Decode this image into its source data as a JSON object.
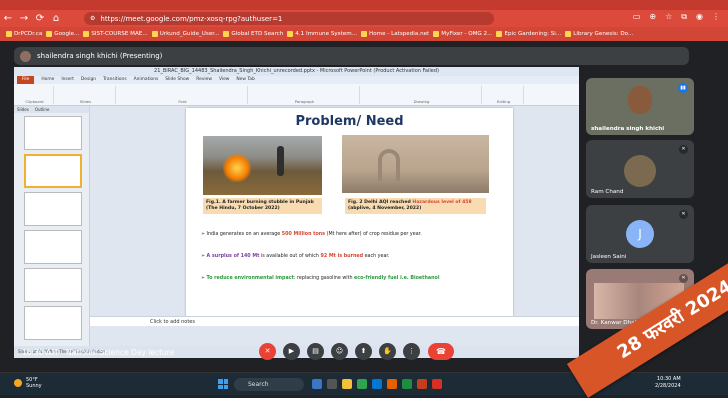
{
  "browser": {
    "url": "https://meet.google.com/pmz-xosq-rpg?authuser=1",
    "bookmarks": [
      "DrPCDr.ca",
      "Google...",
      "SIST-COURSE MAE...",
      "Urkund_Guide_User...",
      "Global ETD Search",
      "4.1 Immune System...",
      "Home - Latspedia.net",
      "MyFixer - OMG 2...",
      "Epic Gardening: Si...",
      "Library Genesis: Do..."
    ]
  },
  "meet": {
    "presenter_banner": "shailendra singh khichi (Presenting)",
    "clock": "10:30 AM",
    "meeting_title": "National Science Day lecture",
    "participants": [
      {
        "name": "shailendra singh khichi",
        "muted": false
      },
      {
        "name": "Ram Chand",
        "muted": true
      },
      {
        "name": "Jasleen Saini",
        "initial": "J",
        "muted": true
      },
      {
        "name": "Dr. Kanwar Dhaliwal",
        "muted": true
      }
    ]
  },
  "ppt": {
    "title_bar": "21_BIRAC_BIG_14483_Shailendra_Singh_Khichi_unrecorded.pptx - Microsoft PowerPoint (Product Activation Failed)",
    "tabs": [
      "File",
      "Home",
      "Insert",
      "Design",
      "Transitions",
      "Animations",
      "Slide Show",
      "Review",
      "View",
      "New Tab"
    ],
    "groups": [
      "Clipboard",
      "Slides",
      "Font",
      "Paragraph",
      "Drawing",
      "Editing"
    ],
    "pane_tabs": [
      "Slides",
      "Outline"
    ],
    "notes_placeholder": "Click to add notes",
    "status": "Slide 2 of 40   \"Office Theme\"   English (India)"
  },
  "slide": {
    "title": "Problem/ Need",
    "caption1": "Fig.1. A farmer burning  stubble in Punjab (The Hindu, 7 October 2022)",
    "caption2_pre": "Fig. 2 Delhi AQI reached ",
    "caption2_red": "Hazardous level of 458",
    "caption2_post": " (abplive, 4 November, 2022)",
    "bullet1_pre": "India generates on an average ",
    "bullet1_red": "500 Million tons",
    "bullet1_post": " (Mt here after) of crop residue per year.",
    "bullet2_purple": "A surplus of 140 Mt",
    "bullet2_mid": " is available out of which ",
    "bullet2_red": "92 Mt is burned",
    "bullet2_post": " each year.",
    "bullet3_green": "To reduce environmental impact",
    "bullet3_mid": ": replacing gasoline with ",
    "bullet3_green2": "eco-friendly fuel i.e. Bioethanol"
  },
  "taskbar": {
    "weather_temp": "50°F",
    "weather_desc": "Sunny",
    "search": "Search",
    "time": "10:30 AM",
    "date": "2/28/2024"
  },
  "overlay_text": "28 फरवरी 2024"
}
